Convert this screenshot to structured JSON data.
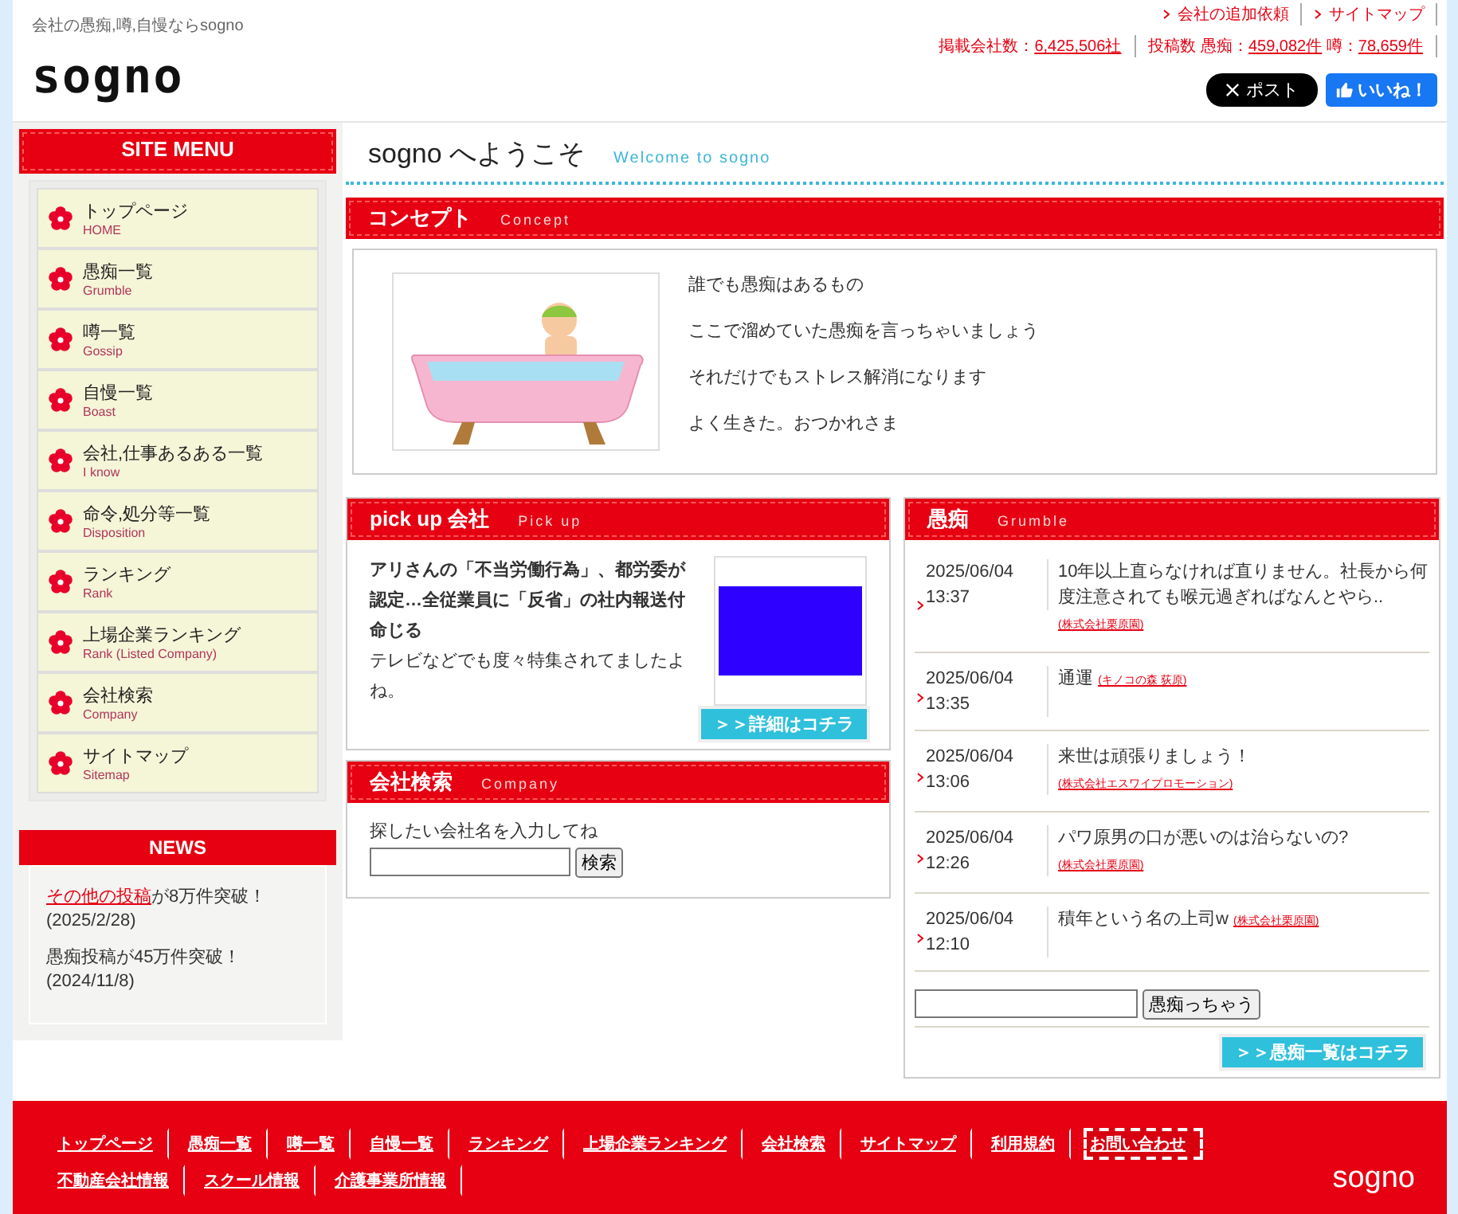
{
  "header": {
    "tagline": "会社の愚痴,噂,自慢ならsogno",
    "logo": "sogno",
    "links": [
      "会社の追加依頼",
      "サイトマップ"
    ],
    "stats": [
      {
        "parts": [
          {
            "text": "掲載会社数：",
            "kind": "label"
          },
          {
            "text": "6,425,506社",
            "kind": "count"
          }
        ]
      },
      {
        "parts": [
          {
            "text": "投稿数 愚痴：",
            "kind": "label"
          },
          {
            "text": "459,082件",
            "kind": "count"
          },
          {
            "text": " 噂：",
            "kind": "label"
          },
          {
            "text": "78,659件",
            "kind": "count"
          }
        ]
      }
    ],
    "post_button": "ポスト",
    "like_button": "いいね！"
  },
  "sidebar": {
    "title": "SITE MENU",
    "items": [
      {
        "label": "トップページ",
        "sub": "HOME"
      },
      {
        "label": "愚痴一覧",
        "sub": "Grumble"
      },
      {
        "label": "噂一覧",
        "sub": "Gossip"
      },
      {
        "label": "自慢一覧",
        "sub": "Boast"
      },
      {
        "label": "会社,仕事あるある一覧",
        "sub": "I know"
      },
      {
        "label": "命令,処分等一覧",
        "sub": "Disposition"
      },
      {
        "label": "ランキング",
        "sub": "Rank"
      },
      {
        "label": "上場企業ランキング",
        "sub": "Rank (Listed Company)"
      },
      {
        "label": "会社検索",
        "sub": "Company"
      },
      {
        "label": "サイトマップ",
        "sub": "Sitemap"
      }
    ]
  },
  "news": {
    "title": "NEWS",
    "items": [
      {
        "link": "その他の投稿",
        "text": "が8万件突破！",
        "date": "(2025/2/28)"
      },
      {
        "text": "愚痴投稿が45万件突破！",
        "date": "(2024/11/8)"
      }
    ]
  },
  "welcome": {
    "title": "sogno へようこそ",
    "sub": "Welcome to sogno"
  },
  "concept": {
    "title": "コンセプト",
    "sub": "Concept",
    "lines": [
      "誰でも愚痴はあるもの",
      "ここで溜めていた愚痴を言っちゃいましょう",
      "それだけでもストレス解消になります",
      "よく生きた。おつかれさま"
    ]
  },
  "pickup": {
    "title": "pick up 会社",
    "sub": "Pick up",
    "headline": "アリさんの「不当労働行為」、都労委が認定…全従業員に「反省」の社内報送付命じる",
    "body": "テレビなどでも度々特集されてましたよね。",
    "button": "＞＞詳細はコチラ"
  },
  "company_search": {
    "title": "会社検索",
    "sub": "Company",
    "prompt": "探したい会社名を入力してね",
    "button": "検索"
  },
  "grumble": {
    "title": "愚痴",
    "sub": "Grumble",
    "entries": [
      {
        "date": "2025/06/04",
        "time": "13:37",
        "text": "10年以上直らなければ直りません。社長から何度注意されても喉元過ぎればなんとやら..",
        "company": "(株式会社栗原園)"
      },
      {
        "date": "2025/06/04",
        "time": "13:35",
        "text": "通運",
        "company": "(キノコの森 荻原)"
      },
      {
        "date": "2025/06/04",
        "time": "13:06",
        "text": "来世は頑張りましょう！",
        "company": "(株式会社エスワイプロモーション)"
      },
      {
        "date": "2025/06/04",
        "time": "12:26",
        "text": "パワ原男の口が悪いのは治らないの?",
        "company": "(株式会社栗原園)"
      },
      {
        "date": "2025/06/04",
        "time": "12:10",
        "text": "積年という名の上司w",
        "company": "(株式会社栗原園)"
      }
    ],
    "button": "愚痴っちゃう",
    "more": "＞＞愚痴一覧はコチラ"
  },
  "footer": {
    "site_links": [
      {
        "label": "トップページ",
        "focused": false
      },
      {
        "label": "愚痴一覧",
        "focused": false
      },
      {
        "label": "噂一覧",
        "focused": false
      },
      {
        "label": "自慢一覧",
        "focused": false
      },
      {
        "label": "ランキング",
        "focused": false
      },
      {
        "label": "上場企業ランキング",
        "focused": false
      },
      {
        "label": "会社検索",
        "focused": false
      },
      {
        "label": "サイトマップ",
        "focused": false
      },
      {
        "label": "利用規約",
        "focused": false
      },
      {
        "label": "お問い合わせ",
        "focused": true
      }
    ],
    "info_links": [
      {
        "label": "不動産会社情報",
        "focused": false
      },
      {
        "label": "スクール情報",
        "focused": false
      },
      {
        "label": "介護事業所情報",
        "focused": false
      }
    ],
    "logo": "sogno"
  }
}
